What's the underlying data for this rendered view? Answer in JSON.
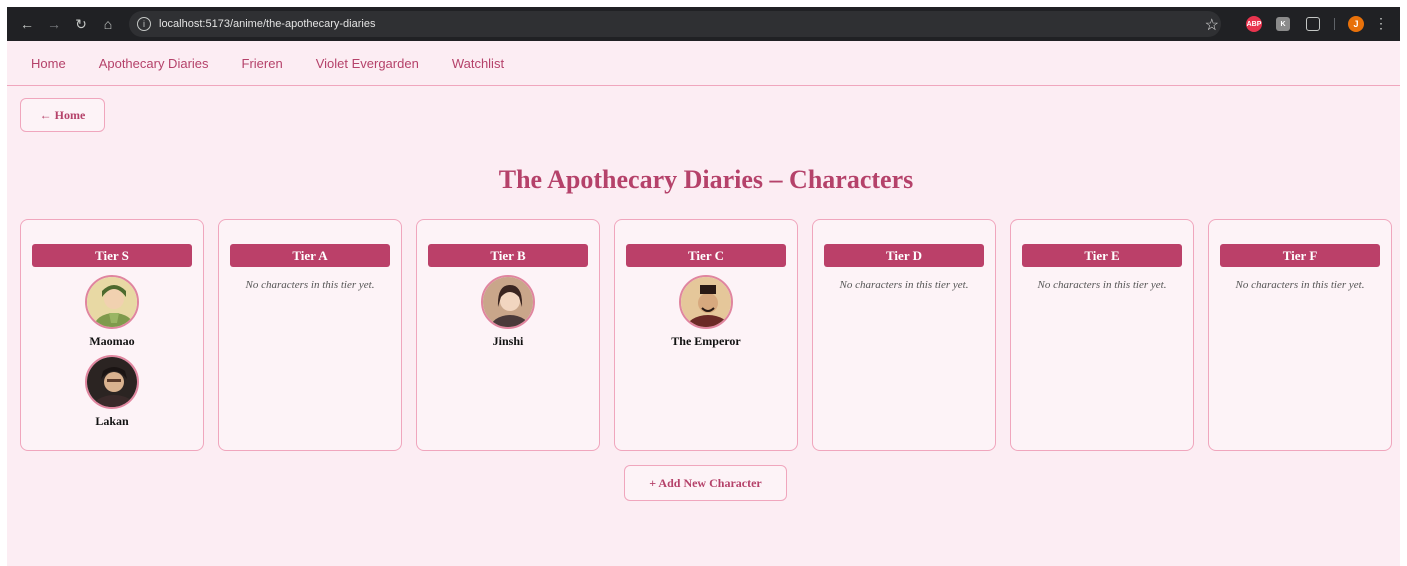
{
  "browser": {
    "url": "localhost:5173/anime/the-apothecary-diaries",
    "ext_abp": "ABP",
    "ext_k": "K",
    "profile_initial": "J"
  },
  "nav": {
    "items": [
      "Home",
      "Apothecary Diaries",
      "Frieren",
      "Violet Evergarden",
      "Watchlist"
    ]
  },
  "back_button": "← Home",
  "title": "The Apothecary Diaries – Characters",
  "tiers": [
    {
      "label": "Tier S",
      "characters": [
        "Maomao",
        "Lakan"
      ]
    },
    {
      "label": "Tier A",
      "empty": "No characters in this tier yet."
    },
    {
      "label": "Tier B",
      "characters": [
        "Jinshi"
      ]
    },
    {
      "label": "Tier C",
      "characters": [
        "The Emperor"
      ]
    },
    {
      "label": "Tier D",
      "empty": "No characters in this tier yet."
    },
    {
      "label": "Tier E",
      "empty": "No characters in this tier yet."
    },
    {
      "label": "Tier F",
      "empty": "No characters in this tier yet."
    }
  ],
  "add_button": "+ Add New Character",
  "colors": {
    "accent": "#bb4069",
    "border": "#f0a6bd",
    "background": "#fcedf3"
  }
}
